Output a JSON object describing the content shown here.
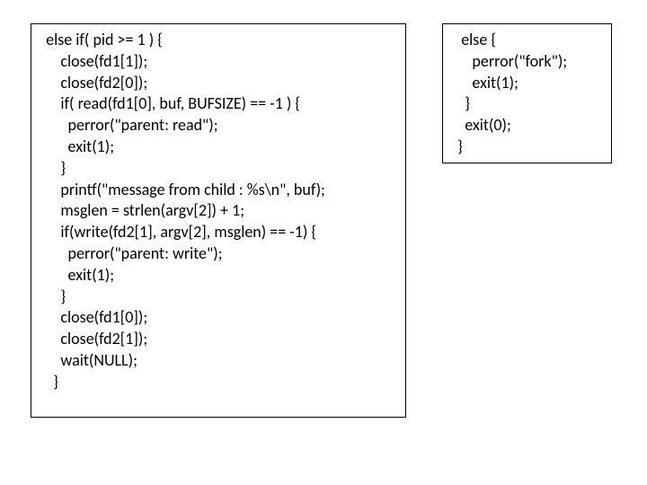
{
  "left_box": {
    "lines": [
      "  else if( pid >= 1 ) {",
      "      close(fd1[1]);",
      "      close(fd2[0]);",
      "      if( read(fd1[0], buf, BUFSIZE) == -1 ) {",
      "        perror(\"parent: read\");",
      "        exit(1);",
      "      }",
      "      printf(\"message from child : %s\\n\", buf);",
      "      msglen = strlen(argv[2]) + 1;",
      "      if(write(fd2[1], argv[2], msglen) == -1) {",
      "        perror(\"parent: write\");",
      "        exit(1);",
      "      }",
      "      close(fd1[0]);",
      "      close(fd2[1]);",
      "      wait(NULL);",
      "    }"
    ]
  },
  "right_box": {
    "lines": [
      "   else {",
      "      perror(\"fork\");",
      "      exit(1);",
      "    }",
      "    exit(0);",
      "  }"
    ]
  }
}
